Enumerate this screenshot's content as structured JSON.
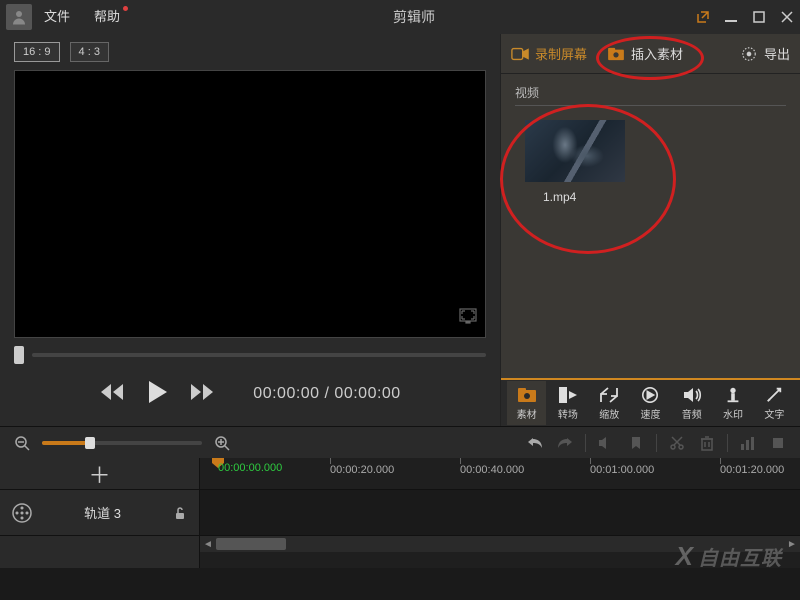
{
  "menu": {
    "file": "文件",
    "help": "帮助"
  },
  "app_title": "剪辑师",
  "aspect": {
    "r169": "16 : 9",
    "r43": "4 : 3"
  },
  "playback": {
    "current": "00:00:00",
    "sep": " / ",
    "total": "00:00:00"
  },
  "side_tabs": {
    "record": "录制屏幕",
    "import": "插入素材",
    "export": "导出"
  },
  "media": {
    "section": "视频",
    "item_name": "1.mp4"
  },
  "tools": {
    "material": "素材",
    "transition": "转场",
    "zoom": "缩放",
    "speed": "速度",
    "audio": "音频",
    "watermark": "水印",
    "text": "文字"
  },
  "timeline": {
    "playhead": "00:00:00.000",
    "ticks": [
      "00:00:20.000",
      "00:00:40.000",
      "00:01:00.000",
      "00:01:20.000"
    ],
    "track_name": "轨道 3"
  },
  "watermark_text": "自由互联"
}
